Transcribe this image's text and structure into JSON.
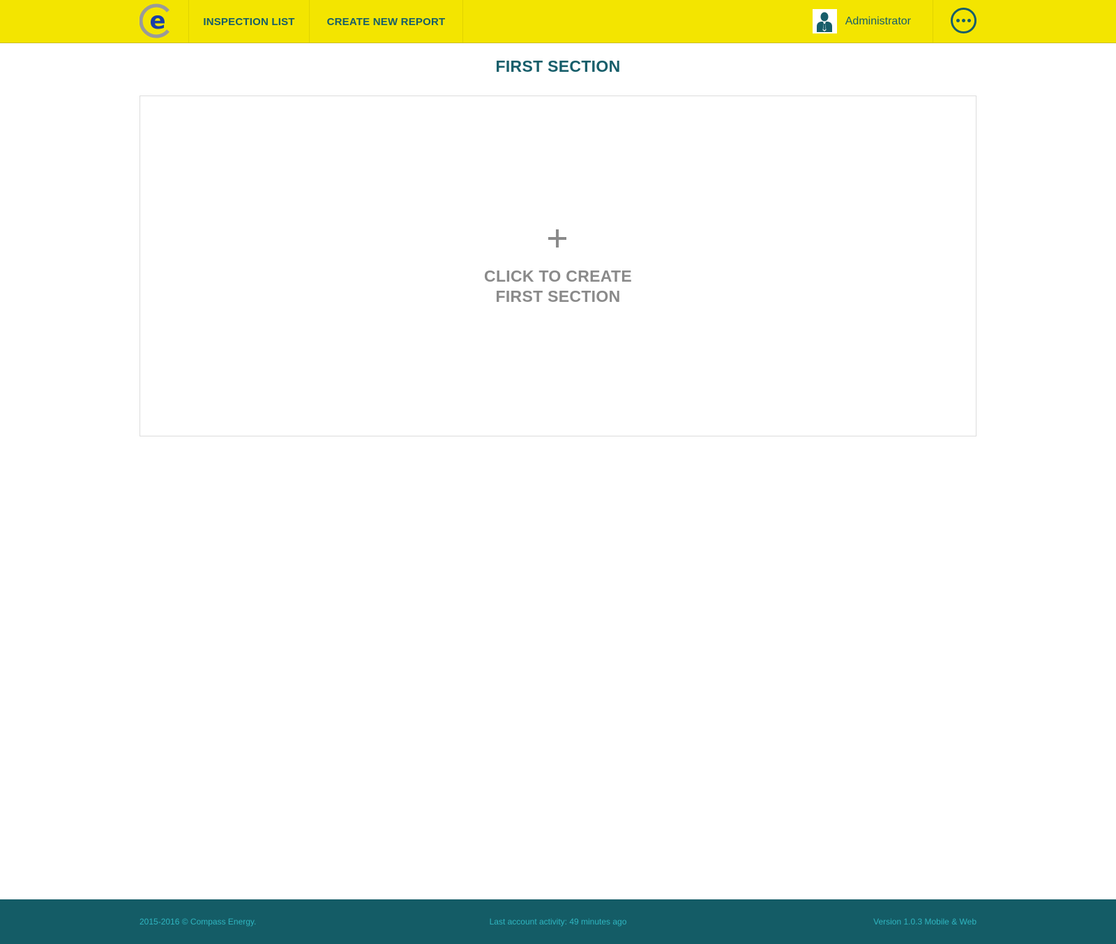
{
  "colors": {
    "header_bg": "#f3e500",
    "primary": "#175e6a",
    "muted": "#8a8a8a",
    "footer_bg": "#145c66",
    "footer_text": "#2fb5c0",
    "logo_blue": "#1a3fa8",
    "logo_grey": "#9a9a9a"
  },
  "header": {
    "logo_icon": "compass-energy-logo",
    "nav": [
      {
        "label": "INSPECTION LIST"
      },
      {
        "label": "CREATE NEW REPORT"
      }
    ],
    "user": {
      "avatar_icon": "user-avatar-icon",
      "name": "Administrator"
    },
    "more_icon": "ellipsis-circle-icon"
  },
  "main": {
    "title": "FIRST SECTION",
    "empty_state": {
      "icon": "plus-icon",
      "line1": "CLICK TO CREATE",
      "line2": "FIRST SECTION"
    }
  },
  "footer": {
    "copyright": "2015-2016 © Compass Energy.",
    "activity": "Last account activity: 49 minutes ago",
    "version": "Version 1.0.3 Mobile & Web"
  }
}
